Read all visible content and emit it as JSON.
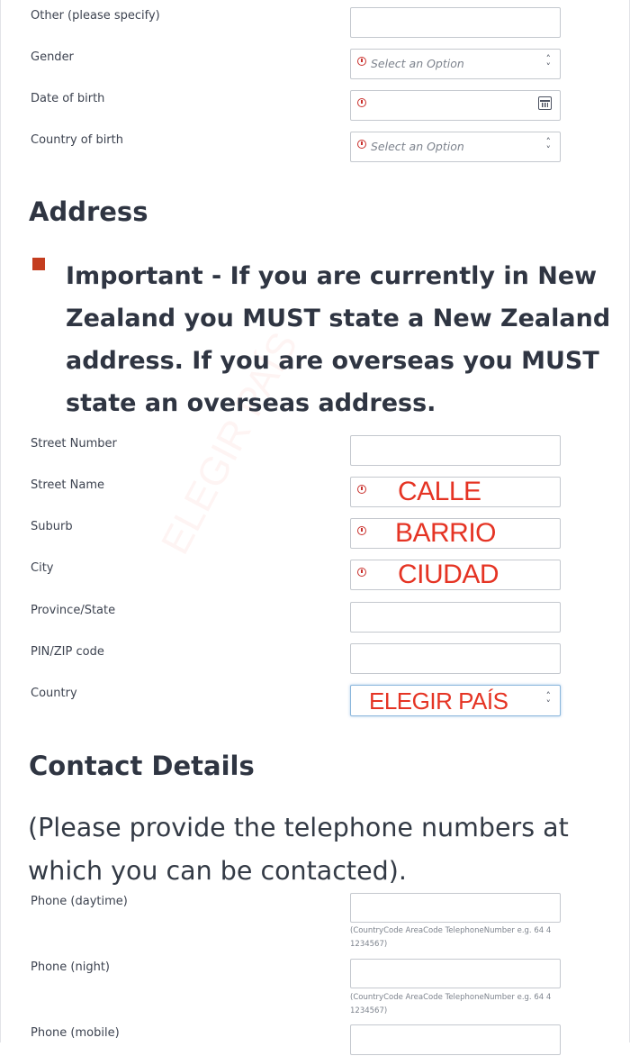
{
  "personal": {
    "other_label": "Other (please specify)",
    "gender_label": "Gender",
    "gender_placeholder": "Select an Option",
    "dob_label": "Date of birth",
    "country_of_birth_label": "Country of birth",
    "country_of_birth_placeholder": "Select an Option"
  },
  "address": {
    "heading": "Address",
    "important_note": "Important - If you are currently in New Zealand you MUST state a New Zealand address. If you are overseas you MUST state an overseas address.",
    "street_number_label": "Street Number",
    "street_name_label": "Street Name",
    "street_name_overlay": "CALLE",
    "suburb_label": "Suburb",
    "suburb_overlay": "BARRIO",
    "city_label": "City",
    "city_overlay": "CIUDAD",
    "province_label": "Province/State",
    "zip_label": "PIN/ZIP code",
    "country_label": "Country",
    "country_overlay": "ELEGIR PAÍS",
    "watermark": "ELEGIR PAÍS"
  },
  "contact": {
    "heading": "Contact Details",
    "intro": "(Please provide the telephone numbers at which you can be contacted).",
    "phone_day_label": "Phone (daytime)",
    "phone_night_label": "Phone (night)",
    "phone_mobile_label": "Phone (mobile)",
    "phone_hint": "(CountryCode AreaCode TelephoneNumber e.g. 64 4 1234567)"
  },
  "colors": {
    "error": "#c9302c",
    "overlay_red": "#e53424",
    "flag": "#c43d1f"
  }
}
